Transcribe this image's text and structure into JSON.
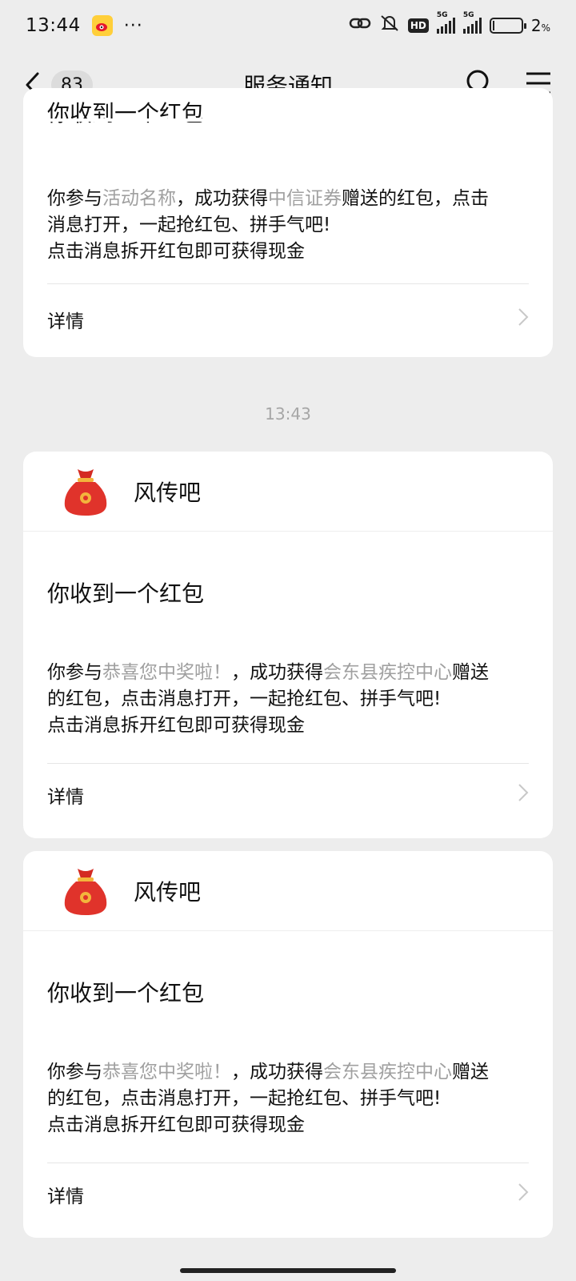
{
  "status_bar": {
    "time": "13:44",
    "dots": "···",
    "signal_label_1": "5G",
    "signal_label_2": "5G",
    "hd": "HD",
    "battery_percent": "2",
    "battery_unit": "%"
  },
  "nav": {
    "back_count": "83",
    "title": "服务通知",
    "icons": [
      "back-icon",
      "search-icon",
      "menu-icon"
    ]
  },
  "timestamp": "13:43",
  "cards": [
    {
      "title_clipped": "你收到一个红包",
      "body_line1_pre": "你参与",
      "body_line1_hl1": "活动名称",
      "body_line1_mid": "，成功获得",
      "body_line1_hl2": "中信证券",
      "body_line1_post": "赠送的红包，点击",
      "body_line2": "消息打开，一起抢红包、拼手气吧!",
      "body_line3": "点击消息拆开红包即可获得现金",
      "footer": "详情"
    },
    {
      "app_name": "风传吧",
      "title": "你收到一个红包",
      "body_pre": "你参与",
      "body_hl1": "恭喜您中奖啦！",
      "body_mid": "，成功获得",
      "body_hl2": "会东县疾控中心",
      "body_post": "赠送",
      "body_line2": "的红包，点击消息打开，一起抢红包、拼手气吧!",
      "body_line3": "点击消息拆开红包即可获得现金",
      "footer": "详情"
    },
    {
      "app_name": "风传吧",
      "title": "你收到一个红包",
      "body_pre": "你参与",
      "body_hl1": "恭喜您中奖啦！",
      "body_mid": "，成功获得",
      "body_hl2": "会东县疾控中心",
      "body_post": "赠送",
      "body_line2": "的红包，点击消息打开，一起抢红包、拼手气吧!",
      "body_line3": "点击消息拆开红包即可获得现金",
      "footer": "详情"
    }
  ],
  "colors": {
    "background": "#ededed",
    "card": "#ffffff",
    "highlight_text": "#a0a0a0",
    "red_packet": "#e0332b"
  }
}
